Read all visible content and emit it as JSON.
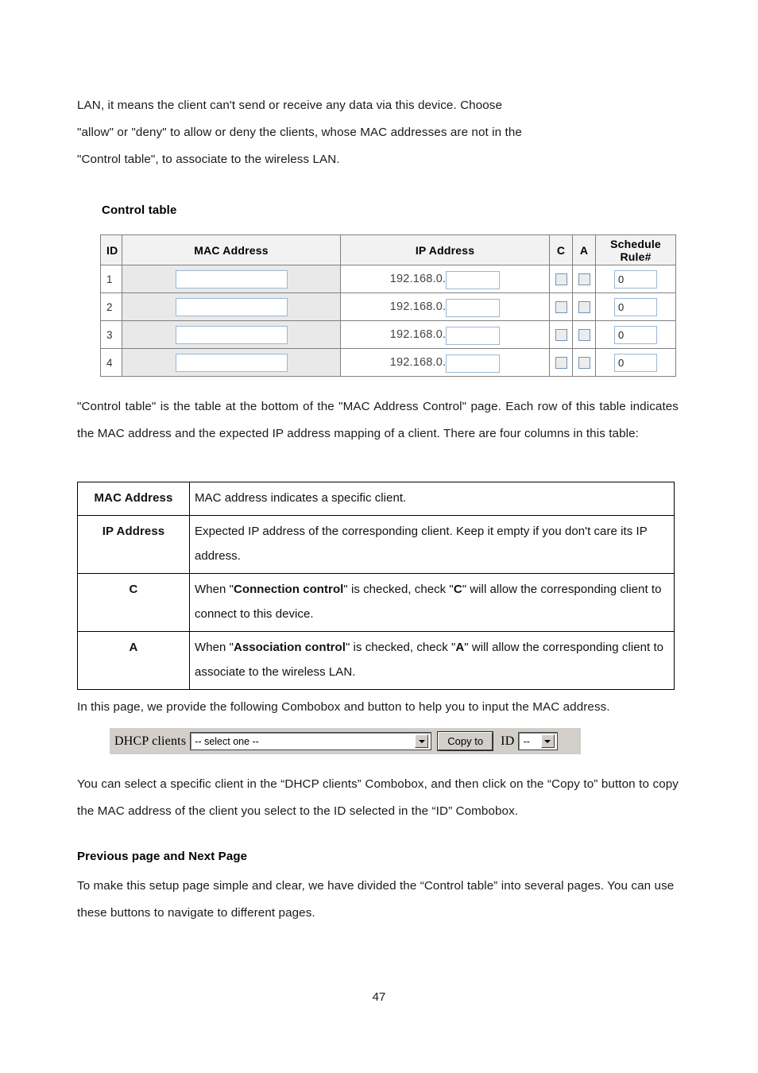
{
  "document": {
    "page_number": "47"
  },
  "intro_paragraph": {
    "lines": [
      "LAN, it means the client can't send or receive any data via this device. Choose",
      "\"allow\" or \"deny\" to allow or deny the clients, whose MAC addresses are not in the",
      "\"Control table\", to associate to the wireless LAN."
    ]
  },
  "control_table_section": {
    "heading": "Control table",
    "columns": [
      "ID",
      "MAC Address",
      "IP Address",
      "C",
      "A",
      "Schedule Rule#"
    ],
    "ip_prefix": "192.168.0.",
    "rows": [
      {
        "id": "1",
        "mac": "",
        "ip_suffix": "",
        "c_checked": false,
        "a_checked": false,
        "schedule_rule": "0"
      },
      {
        "id": "2",
        "mac": "",
        "ip_suffix": "",
        "c_checked": false,
        "a_checked": false,
        "schedule_rule": "0"
      },
      {
        "id": "3",
        "mac": "",
        "ip_suffix": "",
        "c_checked": false,
        "a_checked": false,
        "schedule_rule": "0"
      },
      {
        "id": "4",
        "mac": "",
        "ip_suffix": "",
        "c_checked": false,
        "a_checked": false,
        "schedule_rule": "0"
      }
    ]
  },
  "description_paragraph": {
    "text": "\"Control table\" is the table at the bottom of the \"MAC Address Control\" page. Each row of this table indicates the MAC address and the expected IP address mapping of a client. There are four columns in this table:"
  },
  "definition_table": {
    "rows": [
      {
        "key": "MAC Address",
        "value_parts": [
          {
            "text": "MAC address indicates a specific client.",
            "bold": false
          }
        ]
      },
      {
        "key": "IP Address",
        "value_parts": [
          {
            "text": "Expected IP address of the corresponding client. Keep it empty if you don't care its IP address.",
            "bold": false
          }
        ]
      },
      {
        "key": "C",
        "value_parts": [
          {
            "text": "When \"",
            "bold": false
          },
          {
            "text": "Connection control",
            "bold": true
          },
          {
            "text": "\" is checked, check \"",
            "bold": false
          },
          {
            "text": "C",
            "bold": true
          },
          {
            "text": "\" will allow the corresponding client to connect to this device.",
            "bold": false
          }
        ]
      },
      {
        "key": "A",
        "value_parts": [
          {
            "text": "When \"",
            "bold": false
          },
          {
            "text": "Association control",
            "bold": true
          },
          {
            "text": "\" is checked, check \"",
            "bold": false
          },
          {
            "text": "A",
            "bold": true
          },
          {
            "text": "\" will allow the corresponding client to associate to the wireless LAN.",
            "bold": false
          }
        ]
      }
    ]
  },
  "combobox_intro": {
    "text": "In this page, we provide the following Combobox and button to help you to input the MAC address."
  },
  "dhcp_widget": {
    "label": "DHCP clients",
    "select_value": "-- select one --",
    "copy_button_label": "Copy to",
    "id_label": "ID",
    "id_value": "--"
  },
  "combobox_description": {
    "text": "You can select a specific client in the “DHCP clients” Combobox, and then click on the “Copy to” button to copy the MAC address of the client you select to the ID selected in the “ID” Combobox."
  },
  "previous_next_section": {
    "heading": "Previous page and Next Page",
    "text": "To make this setup page simple and clear, we have divided the “Control table” into several pages. You can use these buttons to navigate to different pages."
  }
}
